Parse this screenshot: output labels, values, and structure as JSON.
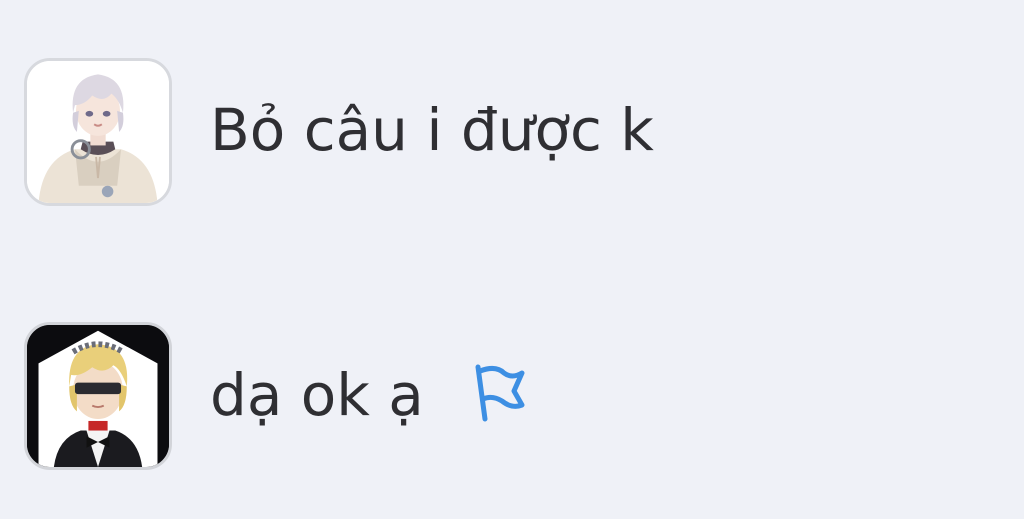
{
  "messages": [
    {
      "avatar_icon": "user-avatar-icon",
      "text": "Bỏ câu i được k"
    },
    {
      "avatar_icon": "user-avatar-icon",
      "text": "dạ ok ạ",
      "action_icon": "flag-icon"
    }
  ],
  "colors": {
    "background": "#eff1f7",
    "text": "#2f2f33",
    "flag": "#3d8fe3"
  }
}
